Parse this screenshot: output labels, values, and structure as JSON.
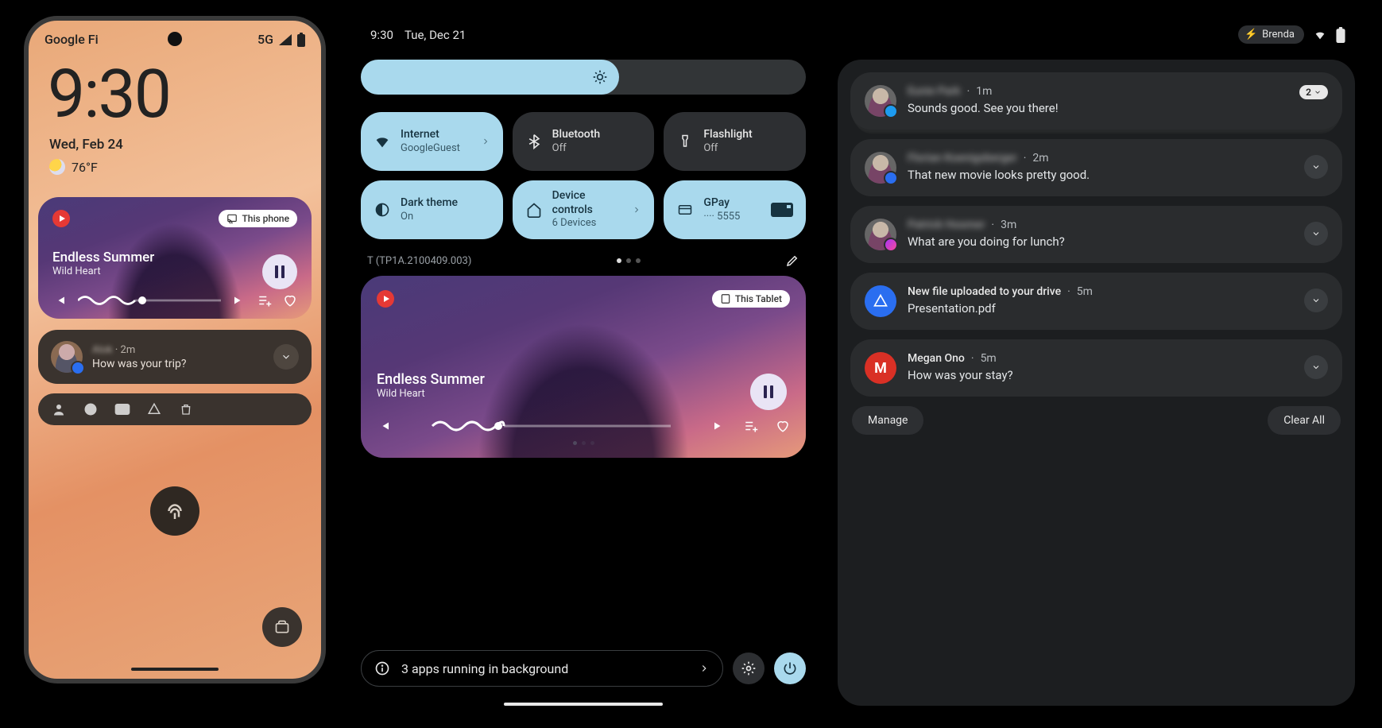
{
  "phone": {
    "carrier": "Google Fi",
    "network": "5G",
    "time": "9:30",
    "date": "Wed, Feb 24",
    "temperature": "76°F",
    "media": {
      "cast_target": "This phone",
      "title": "Endless Summer",
      "artist": "Wild Heart",
      "progress_pct": 42
    },
    "notification": {
      "sender": "Alok",
      "age": "2m",
      "message": "How was your trip?"
    }
  },
  "tablet": {
    "time": "9:30",
    "date": "Tue, Dec 21",
    "user": "Brenda",
    "brightness_pct": 58,
    "tiles": [
      {
        "id": "internet",
        "title": "Internet",
        "sub": "GoogleGuest",
        "active": true,
        "expandable": true
      },
      {
        "id": "bluetooth",
        "title": "Bluetooth",
        "sub": "Off",
        "active": false
      },
      {
        "id": "flashlight",
        "title": "Flashlight",
        "sub": "Off",
        "active": false
      },
      {
        "id": "darktheme",
        "title": "Dark theme",
        "sub": "On",
        "active": true
      },
      {
        "id": "devicecontrols",
        "title": "Device controls",
        "sub": "6 Devices",
        "active": true,
        "expandable": true
      },
      {
        "id": "gpay",
        "title": "GPay",
        "sub": "···· 5555",
        "active": true
      }
    ],
    "build": "T (TP1A.2100409.003)",
    "media": {
      "cast_target": "This Tablet",
      "title": "Endless Summer",
      "artist": "Wild Heart",
      "progress_pct": 30
    },
    "background_apps": "3 apps running in background",
    "notifications": [
      {
        "sender": "Eunie Park",
        "blurred": true,
        "age": "1m",
        "message": "Sounds good. See you there!",
        "count": 2,
        "app": "twitter"
      },
      {
        "sender": "Florian Koenigsberger",
        "blurred": true,
        "age": "2m",
        "message": "That new movie looks pretty good.",
        "app": "messages"
      },
      {
        "sender": "Patrick Hosmer",
        "blurred": true,
        "age": "3m",
        "message": "What are you doing for lunch?",
        "app": "messenger"
      },
      {
        "sender": "New file uploaded to your drive",
        "blurred": false,
        "age": "5m",
        "message": "Presentation.pdf",
        "app": "drive",
        "icon_only": true
      },
      {
        "sender": "Megan Ono",
        "blurred": false,
        "age": "5m",
        "message": "How was your stay?",
        "app": "gmail",
        "icon_only": true
      }
    ],
    "actions": {
      "manage": "Manage",
      "clear": "Clear All"
    }
  }
}
